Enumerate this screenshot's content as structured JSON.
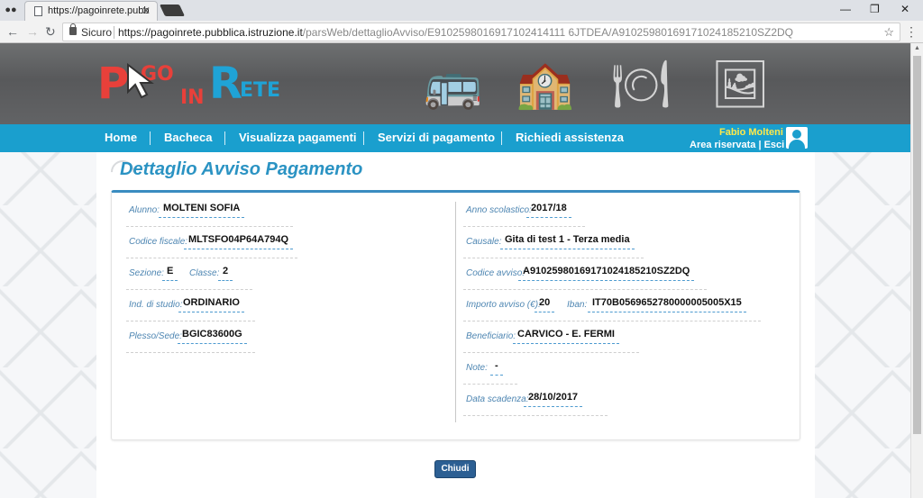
{
  "browser": {
    "tab_title": "https://pagoinrete.pubbl",
    "secure_label": "Sicuro",
    "url_host": "https://pagoinrete.pubblica.istruzione.it",
    "url_path": "/parsWeb/dettaglioAvviso/E9102598016917102414111 6JTDEA/A91025980169171024185210SZ2DQ"
  },
  "site": {
    "logo": {
      "p": "P",
      "go": "GO",
      "in": "IN",
      "r": "R",
      "ete": "ETE"
    },
    "nav": [
      "Home",
      "Bacheca",
      "Visualizza pagamenti",
      "Servizi di pagamento",
      "Richiedi assistenza"
    ],
    "user_name": "Fabio Molteni",
    "area_label": "Area riservata | Esci",
    "colors": {
      "nav_bg": "#1a9fce",
      "title": "#2b93c3",
      "button": "#2c5f93"
    }
  },
  "page": {
    "title": "Dettaglio Avviso Pagamento",
    "left": {
      "alunno_label": "Alunno:",
      "alunno": "MOLTENI SOFIA",
      "cf_label": "Codice fiscale:",
      "cf": "MLTSFO04P64A794Q",
      "sezione_label": "Sezione:",
      "sezione": "E",
      "classe_label": "Classe:",
      "classe": "2",
      "ind_label": "Ind. di studio:",
      "ind": "ORDINARIO",
      "plesso_label": "Plesso/Sede:",
      "plesso": "BGIC83600G"
    },
    "right": {
      "anno_label": "Anno scolastico:",
      "anno": "2017/18",
      "causale_label": "Causale:",
      "causale": "Gita di test 1 - Terza media",
      "codice_label": "Codice avviso:",
      "codice": "A91025980169171024185210SZ2DQ",
      "importo_label": "Importo avviso (€):",
      "importo": "20",
      "iban_label": "Iban:",
      "iban": "IT70B0569652780000005005X15",
      "benef_label": "Beneficiario:",
      "benef": "CARVICO - E. FERMI",
      "note_label": "Note:",
      "note": "-",
      "scad_label": "Data scadenza:",
      "scad": "28/10/2017"
    },
    "close_button": "Chiudi"
  }
}
